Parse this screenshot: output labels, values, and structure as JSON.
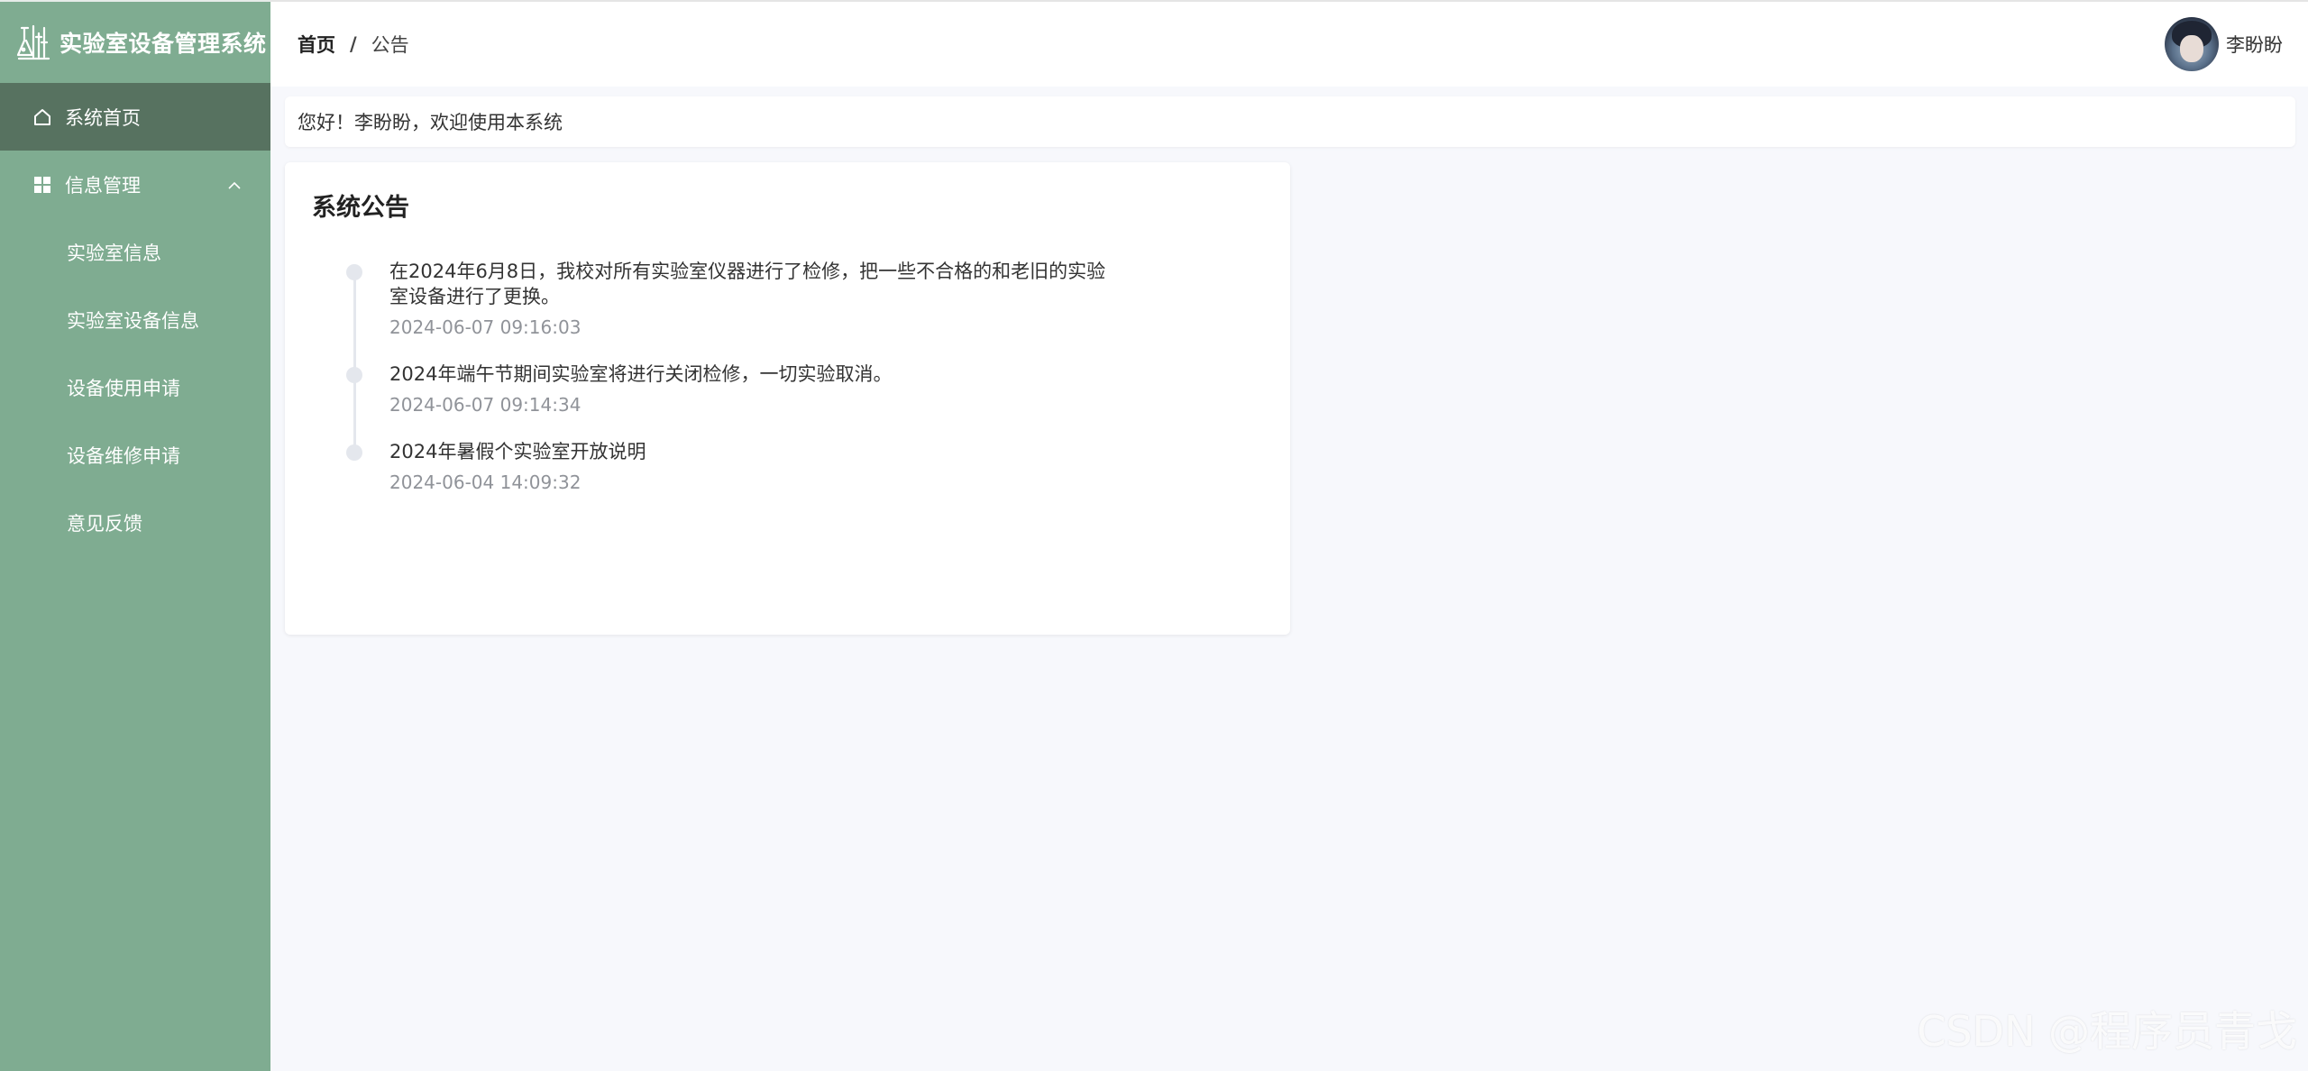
{
  "app": {
    "title": "实验室设备管理系统"
  },
  "sidebar": {
    "home": {
      "label": "系统首页",
      "icon": "home-icon"
    },
    "group": {
      "label": "信息管理",
      "icon": "grid-icon",
      "expanded": true
    },
    "items": [
      {
        "label": "实验室信息"
      },
      {
        "label": "实验室设备信息"
      },
      {
        "label": "设备使用申请"
      },
      {
        "label": "设备维修申请"
      },
      {
        "label": "意见反馈"
      }
    ]
  },
  "header": {
    "breadcrumb": {
      "home": "首页",
      "separator": "/",
      "current": "公告"
    },
    "user": {
      "name": "李盼盼"
    }
  },
  "welcome": {
    "text": "您好！李盼盼，欢迎使用本系统"
  },
  "notice": {
    "title": "系统公告",
    "items": [
      {
        "content": "在2024年6月8日，我校对所有实验室仪器进行了检修，把一些不合格的和老旧的实验室设备进行了更换。",
        "time": "2024-06-07 09:16:03"
      },
      {
        "content": "2024年端午节期间实验室将进行关闭检修，一切实验取消。",
        "time": "2024-06-07 09:14:34"
      },
      {
        "content": "2024年暑假个实验室开放说明",
        "time": "2024-06-04 14:09:32"
      }
    ]
  },
  "watermark": "CSDN @程序员青戈",
  "colors": {
    "sidebar": "#7fac91",
    "sidebar_active": "#577260",
    "background": "#f7f8fc"
  }
}
